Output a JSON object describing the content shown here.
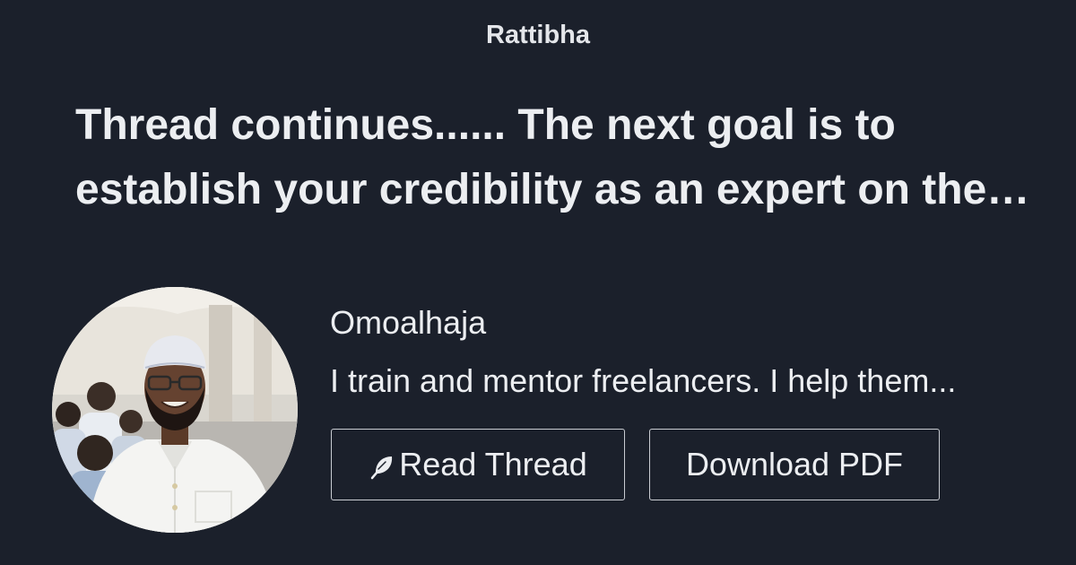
{
  "brand": "Rattibha",
  "thread": {
    "title": "Thread continues...... The next goal is to establish your credibility as an expert on the…"
  },
  "author": {
    "name": "Omoalhaja",
    "bio": "I train and mentor freelancers. I help them..."
  },
  "actions": {
    "read_label": "Read Thread",
    "read_icon": "feather-icon",
    "download_label": "Download PDF"
  },
  "colors": {
    "background": "#1b202b",
    "text": "#eceef1",
    "button_border": "#c9ccd2"
  }
}
